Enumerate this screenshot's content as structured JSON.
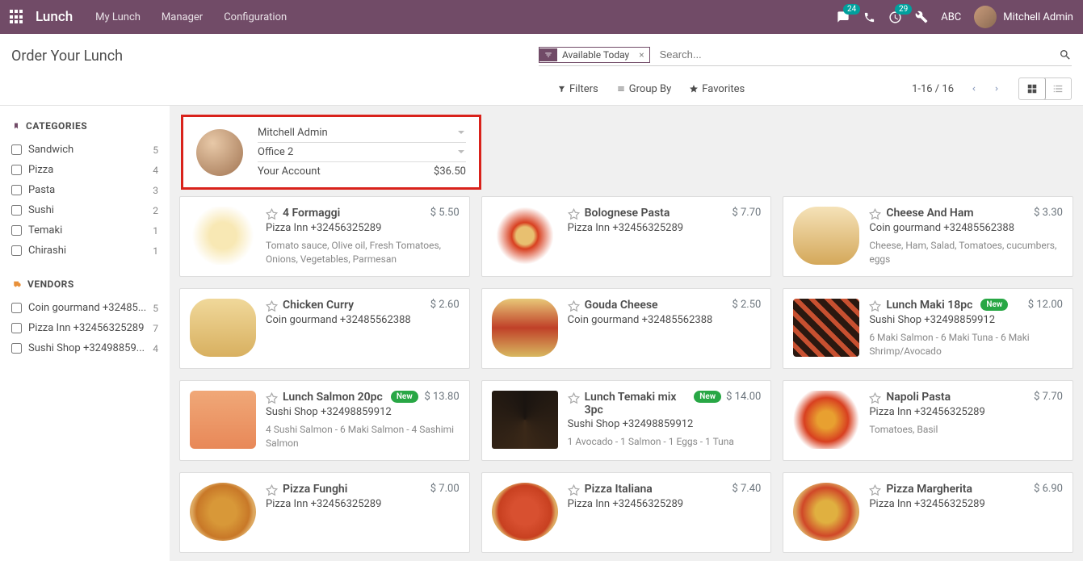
{
  "navbar": {
    "brand": "Lunch",
    "links": [
      "My Lunch",
      "Manager",
      "Configuration"
    ],
    "chat_badge": "24",
    "activity_badge": "29",
    "abc": "ABC",
    "user_name": "Mitchell Admin"
  },
  "header": {
    "title": "Order Your Lunch",
    "filter_chip": "Available Today",
    "search_placeholder": "Search...",
    "filters": "Filters",
    "group_by": "Group By",
    "favorites": "Favorites",
    "pager": "1-16 / 16"
  },
  "sidebar": {
    "categories_title": "CATEGORIES",
    "categories": [
      {
        "label": "Sandwich",
        "count": "5"
      },
      {
        "label": "Pizza",
        "count": "4"
      },
      {
        "label": "Pasta",
        "count": "3"
      },
      {
        "label": "Sushi",
        "count": "2"
      },
      {
        "label": "Temaki",
        "count": "1"
      },
      {
        "label": "Chirashi",
        "count": "1"
      }
    ],
    "vendors_title": "VENDORS",
    "vendors": [
      {
        "label": "Coin gourmand +32485...",
        "count": "5"
      },
      {
        "label": "Pizza Inn +32456325289",
        "count": "7"
      },
      {
        "label": "Sushi Shop +32498859...",
        "count": "4"
      }
    ]
  },
  "account": {
    "user": "Mitchell Admin",
    "location": "Office 2",
    "your_account_label": "Your Account",
    "balance": "$36.50"
  },
  "products": [
    {
      "name": "4 Formaggi",
      "price": "$ 5.50",
      "vendor": "Pizza Inn +32456325289",
      "desc": "Tomato sauce, Olive oil, Fresh Tomatoes, Onions, Vegetables, Parmesan",
      "img": "food-pasta1",
      "new": false
    },
    {
      "name": "Bolognese Pasta",
      "price": "$ 7.70",
      "vendor": "Pizza Inn +32456325289",
      "desc": "",
      "img": "food-pasta2",
      "new": false
    },
    {
      "name": "Cheese And Ham",
      "price": "$ 3.30",
      "vendor": "Coin gourmand +32485562388",
      "desc": "Cheese, Ham, Salad, Tomatoes, cucumbers, eggs",
      "img": "food-sandwich1",
      "new": false
    },
    {
      "name": "Chicken Curry",
      "price": "$ 2.60",
      "vendor": "Coin gourmand +32485562388",
      "desc": "",
      "img": "food-curry",
      "new": false
    },
    {
      "name": "Gouda Cheese",
      "price": "$ 2.50",
      "vendor": "Coin gourmand +32485562388",
      "desc": "",
      "img": "food-sandwich2",
      "new": false
    },
    {
      "name": "Lunch Maki 18pc",
      "price": "$ 12.00",
      "vendor": "Sushi Shop +32498859912",
      "desc": "6 Maki Salmon - 6 Maki Tuna - 6 Maki Shrimp/Avocado",
      "img": "food-maki",
      "new": true
    },
    {
      "name": "Lunch Salmon 20pc",
      "price": "$ 13.80",
      "vendor": "Sushi Shop +32498859912",
      "desc": "4 Sushi Salmon - 6 Maki Salmon - 4 Sashimi Salmon",
      "img": "food-salmon",
      "new": true
    },
    {
      "name": "Lunch Temaki mix 3pc",
      "price": "$ 14.00",
      "vendor": "Sushi Shop +32498859912",
      "desc": "1 Avocado - 1 Salmon - 1 Eggs - 1 Tuna",
      "img": "food-temaki",
      "new": true
    },
    {
      "name": "Napoli Pasta",
      "price": "$ 7.70",
      "vendor": "Pizza Inn +32456325289",
      "desc": "Tomatoes, Basil",
      "img": "food-napoli",
      "new": false
    },
    {
      "name": "Pizza Funghi",
      "price": "$ 7.00",
      "vendor": "Pizza Inn +32456325289",
      "desc": "",
      "img": "food-pizza1",
      "new": false
    },
    {
      "name": "Pizza Italiana",
      "price": "$ 7.40",
      "vendor": "Pizza Inn +32456325289",
      "desc": "",
      "img": "food-pizza2",
      "new": false
    },
    {
      "name": "Pizza Margherita",
      "price": "$ 6.90",
      "vendor": "Pizza Inn +32456325289",
      "desc": "",
      "img": "food-pizza3",
      "new": false
    }
  ],
  "new_label": "New"
}
